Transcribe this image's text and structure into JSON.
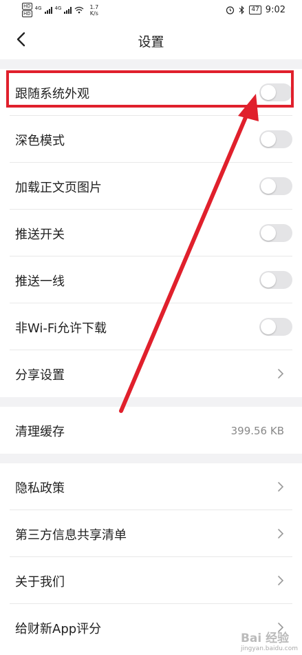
{
  "status_bar": {
    "net_label_1": "HD",
    "net_label_2": "HD",
    "signal_1": "4G",
    "signal_2": "4G",
    "speed_value": "1.7",
    "speed_unit": "K/s",
    "battery": "47",
    "time": "9:02"
  },
  "header": {
    "title": "设置"
  },
  "settings": {
    "follow_system": {
      "label": "跟随系统外观",
      "on": false
    },
    "dark_mode": {
      "label": "深色模式",
      "on": false
    },
    "load_images": {
      "label": "加载正文页图片",
      "on": false
    },
    "push_switch": {
      "label": "推送开关",
      "on": false
    },
    "push_first_line": {
      "label": "推送一线",
      "on": false
    },
    "non_wifi_download": {
      "label": "非Wi-Fi允许下载",
      "on": false
    },
    "share_settings": {
      "label": "分享设置"
    },
    "clear_cache": {
      "label": "清理缓存",
      "value": "399.56 KB"
    },
    "privacy": {
      "label": "隐私政策"
    },
    "third_party": {
      "label": "第三方信息共享清单"
    },
    "about": {
      "label": "关于我们"
    },
    "rate": {
      "label": "给财新App评分"
    }
  },
  "watermark": {
    "brand": "Bai 经验",
    "url": "jingyan.baidu.com"
  },
  "colors": {
    "annotation": "#e0202c",
    "toggle_off": "#e4e4e6",
    "section_gap": "#f2f2f4"
  }
}
